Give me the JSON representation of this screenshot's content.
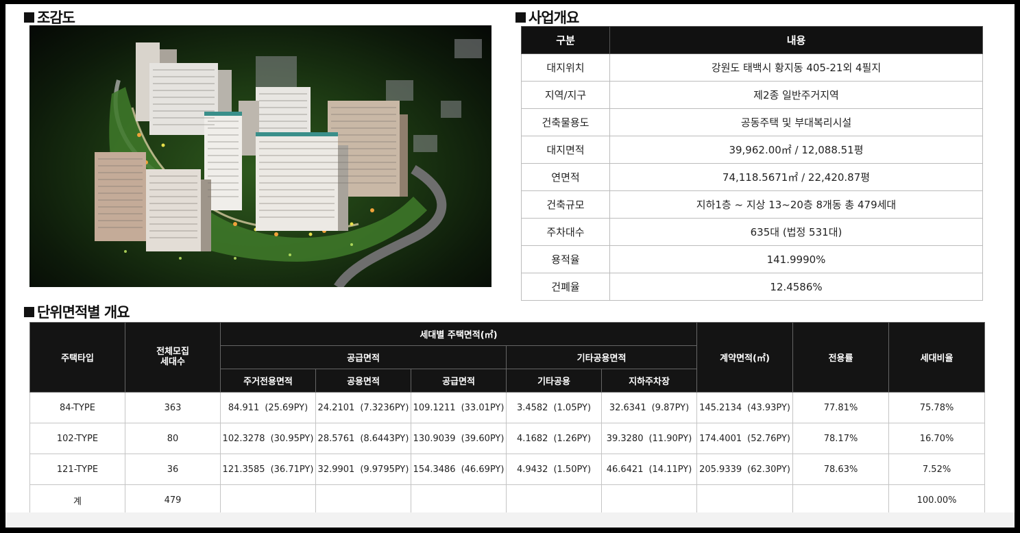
{
  "sections": {
    "aerial_title": "조감도",
    "overview_title": "사업개요",
    "area_title": "단위면적별 개요"
  },
  "overview": {
    "headers": [
      "구분",
      "내용"
    ],
    "rows": [
      {
        "label": "대지위치",
        "value": "강원도 태백시 황지동 405-21외 4필지"
      },
      {
        "label": "지역/지구",
        "value": "제2종 일반주거지역"
      },
      {
        "label": "건축물용도",
        "value": "공동주택 및 부대복리시설"
      },
      {
        "label": "대지면적",
        "value": "39,962.00㎡ / 12,088.51평"
      },
      {
        "label": "연면적",
        "value": "74,118.5671㎡ / 22,420.87평"
      },
      {
        "label": "건축규모",
        "value": "지하1층 ~ 지상 13~20층 8개동 총 479세대"
      },
      {
        "label": "주차대수",
        "value": "635대 (법정 531대)"
      },
      {
        "label": "용적율",
        "value": "141.9990%"
      },
      {
        "label": "건폐율",
        "value": "12.4586%"
      }
    ]
  },
  "area_table": {
    "headers": {
      "type": "주택타입",
      "units": "전체모집\n세대수",
      "household_area": "세대별 주택면적(㎡)",
      "supply_group": "공급면적",
      "other_group": "기타공용면적",
      "residential": "주거전용면적",
      "common": "공용면적",
      "supply": "공급면적",
      "other_common": "기타공용",
      "parking": "지하주차장",
      "contract": "계약면적(㎡)",
      "exclusive_rate": "전용률",
      "ratio": "세대비율"
    },
    "rows": [
      {
        "type": "84-TYPE",
        "units": "363",
        "residential": "84.911",
        "residential_py": "(25.69PY)",
        "common": "24.2101",
        "common_py": "(7.3236PY)",
        "supply": "109.1211",
        "supply_py": "(33.01PY)",
        "other_common": "3.4582",
        "other_common_py": "(1.05PY)",
        "parking": "32.6341",
        "parking_py": "(9.87PY)",
        "contract": "145.2134",
        "contract_py": "(43.93PY)",
        "exclusive_rate": "77.81%",
        "ratio": "75.78%"
      },
      {
        "type": "102-TYPE",
        "units": "80",
        "residential": "102.3278",
        "residential_py": "(30.95PY)",
        "common": "28.5761",
        "common_py": "(8.6443PY)",
        "supply": "130.9039",
        "supply_py": "(39.60PY)",
        "other_common": "4.1682",
        "other_common_py": "(1.26PY)",
        "parking": "39.3280",
        "parking_py": "(11.90PY)",
        "contract": "174.4001",
        "contract_py": "(52.76PY)",
        "exclusive_rate": "78.17%",
        "ratio": "16.70%"
      },
      {
        "type": "121-TYPE",
        "units": "36",
        "residential": "121.3585",
        "residential_py": "(36.71PY)",
        "common": "32.9901",
        "common_py": "(9.9795PY)",
        "supply": "154.3486",
        "supply_py": "(46.69PY)",
        "other_common": "4.9432",
        "other_common_py": "(1.50PY)",
        "parking": "46.6421",
        "parking_py": "(14.11PY)",
        "contract": "205.9339",
        "contract_py": "(62.30PY)",
        "exclusive_rate": "78.63%",
        "ratio": "7.52%"
      }
    ],
    "total": {
      "label": "계",
      "units": "479",
      "ratio": "100.00%"
    }
  }
}
